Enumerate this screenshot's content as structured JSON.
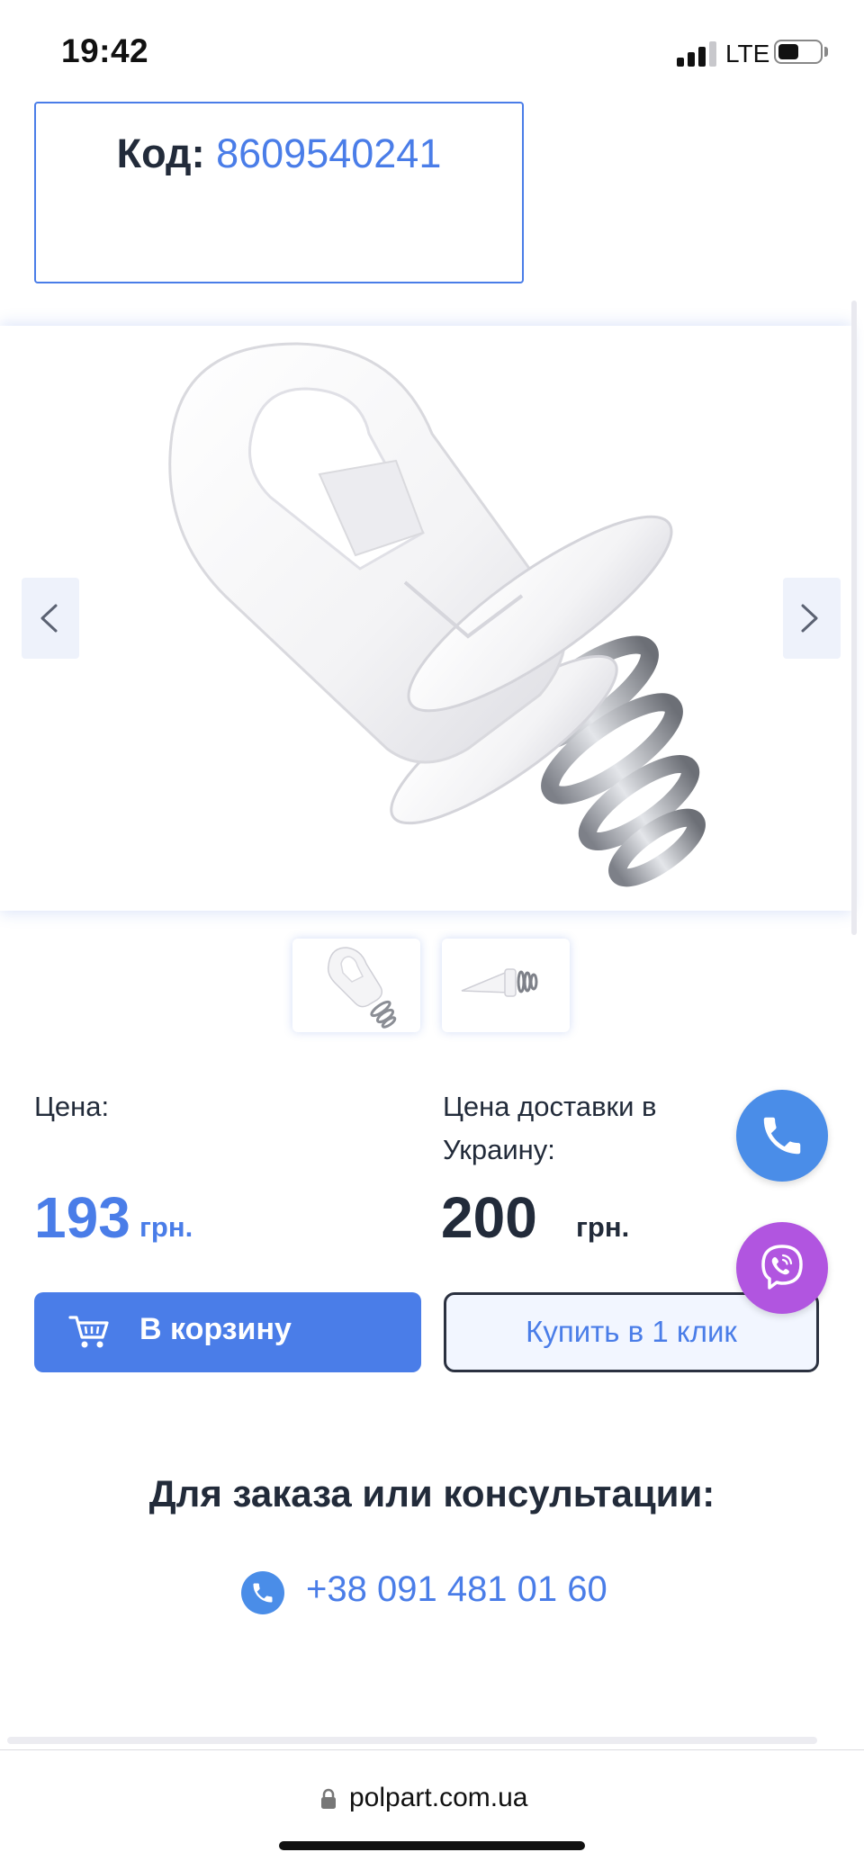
{
  "status_bar": {
    "time": "19:42",
    "network": "LTE",
    "signal_bars": 3,
    "battery_level": 0.4
  },
  "product_code": {
    "label": "Код:",
    "value": "8609540241"
  },
  "gallery": {
    "prev_icon": "chevron-left-icon",
    "next_icon": "chevron-right-icon",
    "thumbnail_count": 2,
    "active_thumbnail": 1
  },
  "price": {
    "label": "Цена:",
    "value": "193",
    "currency": "грн."
  },
  "delivery_price": {
    "label": "Цена доставки в Украину:",
    "value": "200",
    "currency": "грн."
  },
  "buttons": {
    "cart_label": "В корзину",
    "cart_icon": "cart-icon",
    "buy_one_click_label": "Купить в 1 клик"
  },
  "floating": {
    "phone_icon": "phone-icon",
    "viber_icon": "viber-icon"
  },
  "contact": {
    "title": "Для заказа или консультации:",
    "phone": "+38 091 481 01 60"
  },
  "browser": {
    "url": "polpart.com.ua"
  },
  "colors": {
    "accent": "#4a7de8",
    "text_dark": "#222b3a",
    "viber": "#b155e0",
    "phone": "#4a8de8"
  }
}
